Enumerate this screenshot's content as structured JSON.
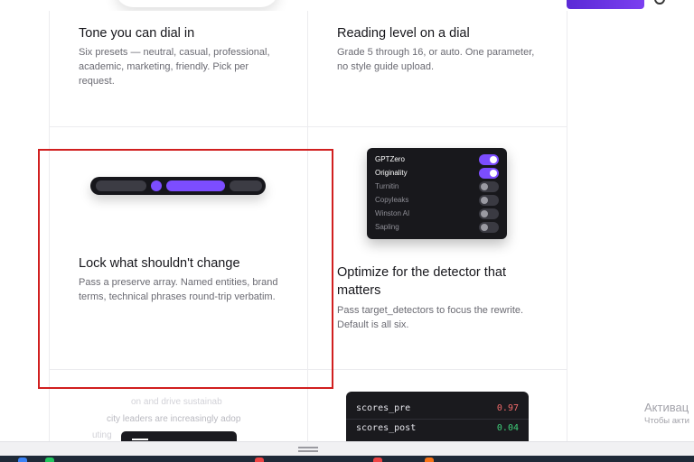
{
  "features": [
    {
      "title": "Tone you can dial in",
      "desc": [
        "Six presets — neutral, casual, professional,",
        "academic, marketing, friendly. Pick per",
        "request."
      ]
    },
    {
      "title": "Reading level on a dial",
      "desc": [
        "Grade 5 through 16, or auto. One parameter,",
        "no style guide upload."
      ]
    },
    {
      "title": "Lock what shouldn't change",
      "desc": [
        "Pass a preserve array. Named entities, brand",
        "terms, technical phrases round-trip verbatim."
      ]
    },
    {
      "title": [
        "Optimize for the detector that",
        "matters"
      ],
      "desc": [
        "Pass target_detectors to focus the rewrite.",
        "Default is all six."
      ]
    }
  ],
  "detectors": [
    {
      "name": "GPTZero",
      "enabled": true
    },
    {
      "name": "Originality",
      "enabled": true
    },
    {
      "name": "Turnitin",
      "enabled": false
    },
    {
      "name": "Copyleaks",
      "enabled": false
    },
    {
      "name": "Winston AI",
      "enabled": false
    },
    {
      "name": "Sapling",
      "enabled": false
    }
  ],
  "testimonial_lines": [
    "on and drive sustainab",
    "city leaders are increasingly adop",
    "uting"
  ],
  "scores": [
    {
      "label": "scores_pre",
      "value": "0.97",
      "color": "#f06a6a"
    },
    {
      "label": "scores_post",
      "value": "0.04",
      "color": "#3ecf7a"
    }
  ],
  "watermark": {
    "title": "Активац",
    "subtitle": "Чтобы акти"
  },
  "colors": {
    "accent": "#7c4dff",
    "highlight": "#d11f1f"
  }
}
